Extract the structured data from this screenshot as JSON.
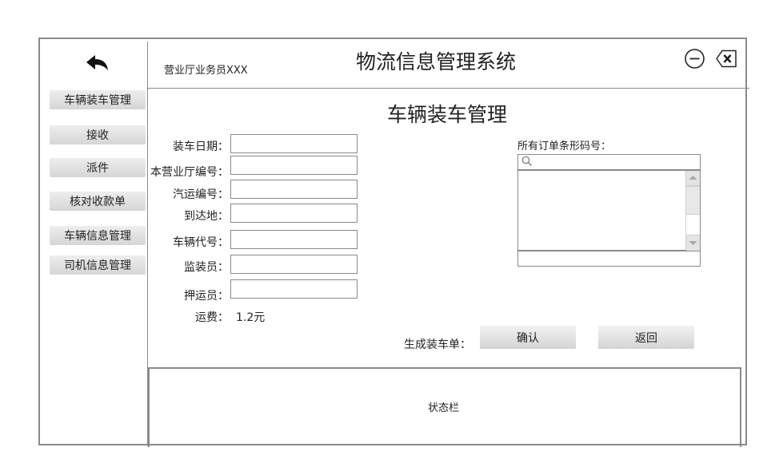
{
  "header": {
    "operator": "营业厅业务员XXX",
    "system_title": "物流信息管理系统"
  },
  "sidebar": {
    "items": [
      {
        "label": "车辆装车管理"
      },
      {
        "label": "接收"
      },
      {
        "label": "派件"
      },
      {
        "label": "核对收款单"
      },
      {
        "label": "车辆信息管理"
      },
      {
        "label": "司机信息管理"
      }
    ]
  },
  "main": {
    "page_title": "车辆装车管理",
    "fields": [
      {
        "label": "装车日期：",
        "value": ""
      },
      {
        "label": "本营业厅编号：",
        "value": ""
      },
      {
        "label": "汽运编号：",
        "value": ""
      },
      {
        "label": "到达地：",
        "value": ""
      },
      {
        "label": "车辆代号：",
        "value": ""
      },
      {
        "label": "监装员：",
        "value": ""
      },
      {
        "label": "押运员：",
        "value": ""
      }
    ],
    "fee_label": "运费：",
    "fee_value": "1.2元",
    "barcode": {
      "label": "所有订单条形码号：",
      "search_value": "",
      "items": [],
      "input_value": ""
    },
    "generate_label": "生成装车单：",
    "confirm_label": "确认",
    "back_label": "返回"
  },
  "status_bar": {
    "text": "状态栏"
  },
  "icons": {
    "back": "back-arrow-icon",
    "minimize": "minimize-icon",
    "close": "close-icon",
    "search": "search-icon"
  }
}
